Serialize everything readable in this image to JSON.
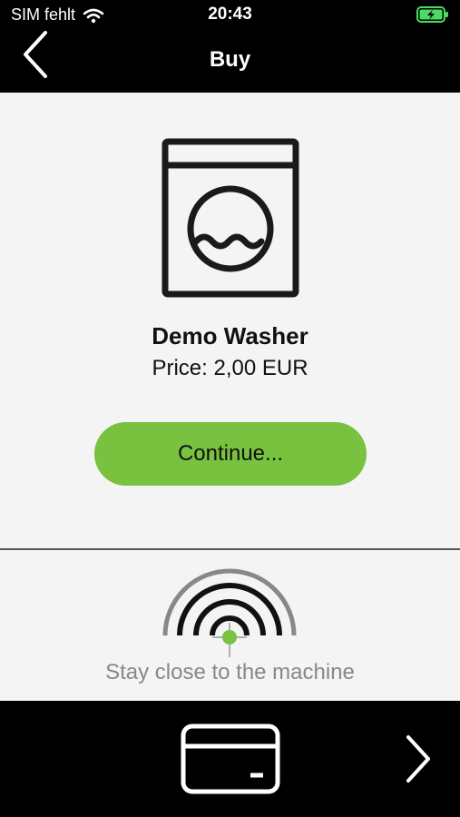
{
  "status_bar": {
    "carrier": "SIM fehlt",
    "time": "20:43",
    "wifi_icon": "wifi-icon",
    "battery_icon": "battery-charging-icon"
  },
  "nav": {
    "title": "Buy",
    "back_icon": "chevron-left-icon"
  },
  "product": {
    "icon": "washing-machine-icon",
    "name": "Demo Washer",
    "price": "Price: 2,00 EUR",
    "continue_label": "Continue..."
  },
  "proximity": {
    "icon": "signal-proximity-icon",
    "text": "Stay close to the machine"
  },
  "footer": {
    "card_icon": "credit-card-icon",
    "next_icon": "chevron-right-icon"
  },
  "colors": {
    "accent": "#78c23f",
    "battery": "#4cd964",
    "header_bg": "#000000",
    "content_bg": "#f4f4f4",
    "hint_text": "#888888"
  }
}
